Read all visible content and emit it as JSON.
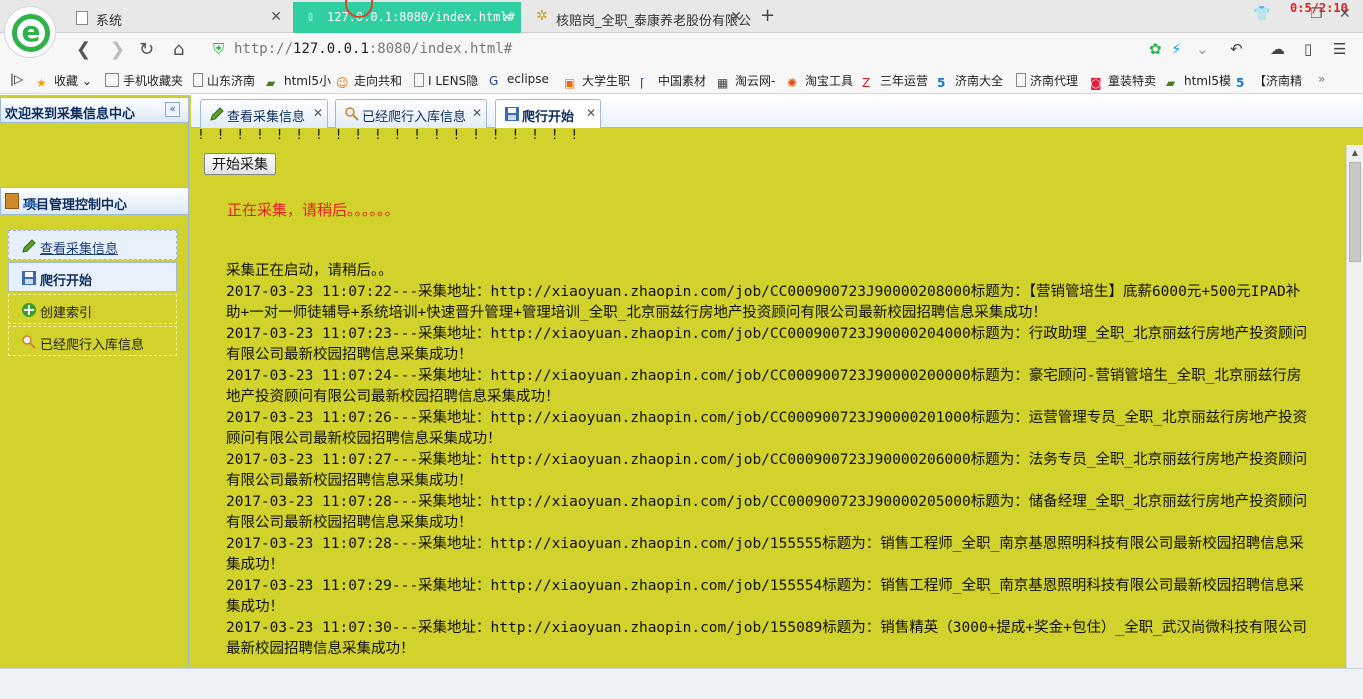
{
  "browser": {
    "tabs": [
      {
        "label": "系统",
        "active": false
      },
      {
        "label": "127.0.0.1:8080/index.html#",
        "active": true
      },
      {
        "label": "核赔岗_全职_泰康养老股份有限公",
        "active": false
      }
    ],
    "timer": "0:5/2:10",
    "address": {
      "scheme": "http://",
      "host": "127.0.0.1",
      "rest": ":8080/index.html#"
    },
    "bookmarks": [
      {
        "label": "收藏",
        "icon": "star-icon"
      },
      {
        "label": "手机收藏夹",
        "icon": "folder-icon"
      },
      {
        "label": "山东济南",
        "icon": "page-icon"
      },
      {
        "label": "html5小",
        "icon": "tank-icon"
      },
      {
        "label": "走向共和",
        "icon": "face-icon"
      },
      {
        "label": "I LENS隐",
        "icon": "page-icon"
      },
      {
        "label": "eclipse",
        "icon": "g-icon"
      },
      {
        "label": "大学生职",
        "icon": "orange-icon"
      },
      {
        "label": "中国素材",
        "icon": "bracket-icon"
      },
      {
        "label": "淘云网-",
        "icon": "grid-icon"
      },
      {
        "label": "淘宝工具",
        "icon": "fan-icon"
      },
      {
        "label": "三年运营",
        "icon": "z-icon"
      },
      {
        "label": "济南大全",
        "icon": "58-icon"
      },
      {
        "label": "济南代理",
        "icon": "page-icon"
      },
      {
        "label": "童装特卖",
        "icon": "bag-icon"
      },
      {
        "label": "html5模",
        "icon": "tank-icon"
      },
      {
        "label": "【济南精",
        "icon": "58-icon"
      }
    ]
  },
  "sidebar": {
    "welcome": "欢迎来到采集信息中心",
    "panel_title": "项目管理控制中心",
    "items": [
      {
        "label": "查看采集信息",
        "icon": "pencil-icon"
      },
      {
        "label": "爬行开始",
        "icon": "save-icon"
      },
      {
        "label": "创建索引",
        "icon": "plus-icon"
      },
      {
        "label": "已经爬行入库信息",
        "icon": "magnifier-icon"
      }
    ]
  },
  "content": {
    "tabs": [
      {
        "label": "查看采集信息",
        "icon": "pencil-icon"
      },
      {
        "label": "已经爬行入库信息",
        "icon": "magnifier-icon"
      },
      {
        "label": "爬行开始",
        "icon": "save-icon"
      }
    ],
    "exclaims": "! ! ! ! ! ! ! ! ! ! ! ! ! ! ! ! ! ! ! !",
    "start_button": "开始采集",
    "collecting_text": "正在采集，请稍后。。。。。。",
    "log_lines": [
      "采集正在启动，请稍后。。",
      "2017-03-23 11:07:22---采集地址：http://xiaoyuan.zhaopin.com/job/CC000900723J90000208000标题为：【营销管培生】底薪6000元+500元IPAD补助+一对一师徒辅导+系统培训+快速晋升管理+管理培训_全职_北京丽兹行房地产投资顾问有限公司最新校园招聘信息采集成功！",
      "2017-03-23 11:07:23---采集地址：http://xiaoyuan.zhaopin.com/job/CC000900723J90000204000标题为：行政助理_全职_北京丽兹行房地产投资顾问有限公司最新校园招聘信息采集成功！",
      "2017-03-23 11:07:24---采集地址：http://xiaoyuan.zhaopin.com/job/CC000900723J90000200000标题为：豪宅顾问-营销管培生_全职_北京丽兹行房地产投资顾问有限公司最新校园招聘信息采集成功！",
      "2017-03-23 11:07:26---采集地址：http://xiaoyuan.zhaopin.com/job/CC000900723J90000201000标题为：运营管理专员_全职_北京丽兹行房地产投资顾问有限公司最新校园招聘信息采集成功！",
      "2017-03-23 11:07:27---采集地址：http://xiaoyuan.zhaopin.com/job/CC000900723J90000206000标题为：法务专员_全职_北京丽兹行房地产投资顾问有限公司最新校园招聘信息采集成功！",
      "2017-03-23 11:07:28---采集地址：http://xiaoyuan.zhaopin.com/job/CC000900723J90000205000标题为：储备经理_全职_北京丽兹行房地产投资顾问有限公司最新校园招聘信息采集成功！",
      "2017-03-23 11:07:28---采集地址：http://xiaoyuan.zhaopin.com/job/155555标题为：销售工程师_全职_南京基恩照明科技有限公司最新校园招聘信息采集成功！",
      "2017-03-23 11:07:29---采集地址：http://xiaoyuan.zhaopin.com/job/155554标题为：销售工程师_全职_南京基恩照明科技有限公司最新校园招聘信息采集成功！",
      "2017-03-23 11:07:30---采集地址：http://xiaoyuan.zhaopin.com/job/155089标题为：销售精英（3000+提成+奖金+包住）_全职_武汉尚微科技有限公司最新校园招聘信息采集成功！"
    ]
  },
  "colors": {
    "app_bg": "#d2d22c",
    "accent_tab": "#2fcfa1",
    "status_red": "#e32222",
    "panel_border": "#9fb9d8"
  }
}
